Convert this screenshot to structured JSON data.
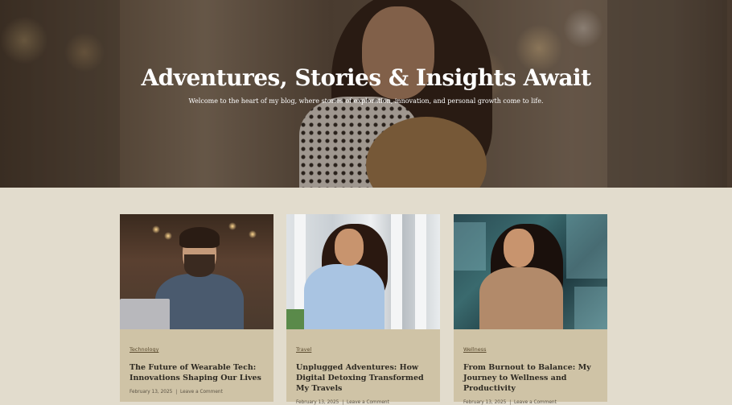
{
  "hero": {
    "title": "Adventures, Stories & Insights Await",
    "subtitle": "Welcome to the heart of my blog, where stories of exploration, innovation, and personal growth come to life."
  },
  "posts": [
    {
      "category": "Technology",
      "title": "The Future of Wearable Tech: Innovations Shaping Our Lives",
      "date": "February 13, 2025",
      "comment_link": "Leave a Comment"
    },
    {
      "category": "Travel",
      "title": "Unplugged Adventures: How Digital Detoxing Transformed My Travels",
      "date": "February 13, 2025",
      "comment_link": "Leave a Comment"
    },
    {
      "category": "Wellness",
      "title": "From Burnout to Balance: My Journey to Wellness and Productivity",
      "date": "February 13, 2025",
      "comment_link": "Leave a Comment"
    }
  ],
  "meta_separator": "|",
  "colors": {
    "page_background": "#e2dccd",
    "card_background": "#cfc3a6",
    "category_text": "#5a4a2e",
    "title_text": "#2e2a22"
  }
}
